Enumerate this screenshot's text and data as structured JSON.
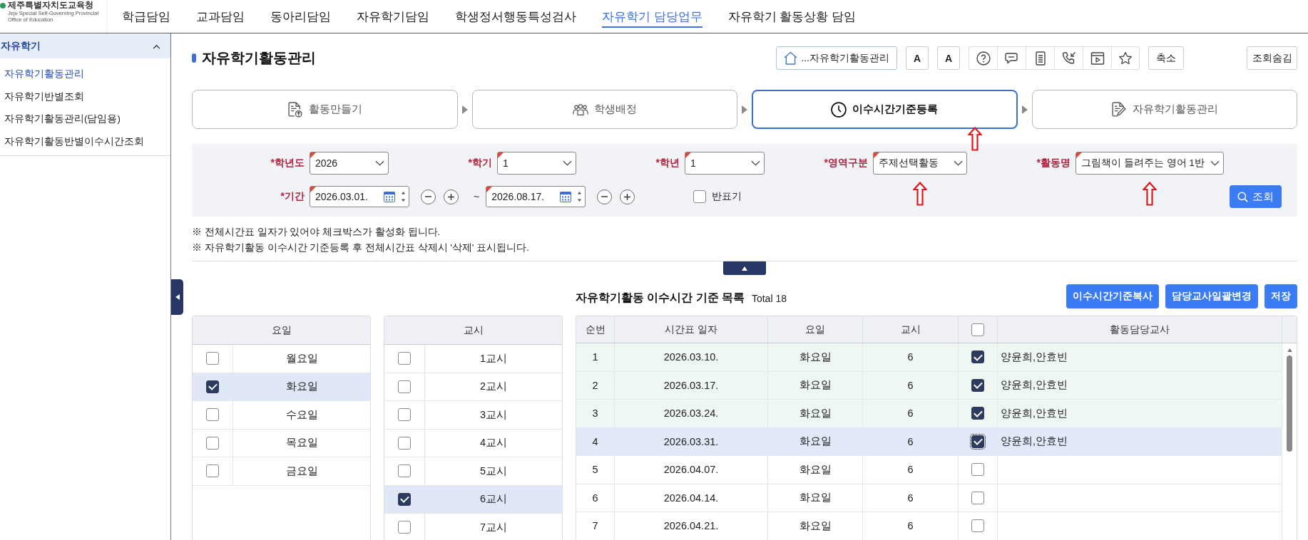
{
  "header": {
    "logo": {
      "title": "제주특별자치도교육청",
      "subtitle": "Jeju Special Self-Governing Provincial Office of Education"
    },
    "nav": [
      {
        "label": "학급담임",
        "selected": false
      },
      {
        "label": "교과담임",
        "selected": false
      },
      {
        "label": "동아리담임",
        "selected": false
      },
      {
        "label": "자유학기담임",
        "selected": false
      },
      {
        "label": "학생정서행동특성검사",
        "selected": false
      },
      {
        "label": "자유학기 담당업무",
        "selected": true
      },
      {
        "label": "자유학기 활동상황 담임",
        "selected": false
      }
    ]
  },
  "sidebar": {
    "title": "자유학기",
    "expanded": true,
    "items": [
      {
        "label": "자유학기활동관리",
        "selected": true
      },
      {
        "label": "자유학기반별조회",
        "selected": false
      },
      {
        "label": "자유학기활동관리(담임용)",
        "selected": false
      },
      {
        "label": "자유학기활동반별이수시간조회",
        "selected": false
      }
    ]
  },
  "page": {
    "title": "자유학기활동관리"
  },
  "toolbar": {
    "breadcrumb": "...자유학기활동관리",
    "font_buttons": [
      "A",
      "A"
    ],
    "collapse_button": "축소",
    "hide_search_button": "조회숨김"
  },
  "steps": [
    {
      "label": "활동만들기",
      "selected": false,
      "marked": false
    },
    {
      "label": "학생배정",
      "selected": false,
      "marked": false
    },
    {
      "label": "이수시간기준등록",
      "selected": true,
      "marked": true
    },
    {
      "label": "자유학기활동관리",
      "selected": false,
      "marked": false
    }
  ],
  "filters": {
    "selects": [
      {
        "label": "*학년도",
        "value": "2026",
        "marked": false
      },
      {
        "label": "*학기",
        "value": "1",
        "marked": false
      },
      {
        "label": "*학년",
        "value": "1",
        "marked": false
      },
      {
        "label": "*영역구분",
        "value": "주제선택활동",
        "marked": true
      },
      {
        "label": "*활동명",
        "value": "그림책이 들려주는 영어 1반",
        "marked": true
      }
    ],
    "period": {
      "label": "*기간",
      "start": "2026.03.01.",
      "separator": "~",
      "end": "2026.08.17."
    },
    "class_display": {
      "label": "반표기",
      "checked": false
    },
    "search_button": "조회"
  },
  "notes": [
    "※ 전체시간표 일자가 있어야 체크박스가 활성화 됩니다.",
    "※ 자유학기활동 이수시간 기준등록 후 전체시간표 삭제시 '삭제' 표시됩니다."
  ],
  "day_table": {
    "header": "요일",
    "rows": [
      {
        "label": "월요일",
        "checked": false
      },
      {
        "label": "화요일",
        "checked": true
      },
      {
        "label": "수요일",
        "checked": false
      },
      {
        "label": "목요일",
        "checked": false
      },
      {
        "label": "금요일",
        "checked": false
      }
    ]
  },
  "period_table": {
    "header": "교시",
    "rows": [
      {
        "label": "1교시",
        "checked": false
      },
      {
        "label": "2교시",
        "checked": false
      },
      {
        "label": "3교시",
        "checked": false
      },
      {
        "label": "4교시",
        "checked": false
      },
      {
        "label": "5교시",
        "checked": false
      },
      {
        "label": "6교시",
        "checked": true
      },
      {
        "label": "7교시",
        "checked": false
      }
    ]
  },
  "schedule": {
    "title": "자유학기활동 이수시간 기준 목록",
    "total": "Total 18",
    "buttons": [
      "이수시간기준복사",
      "담당교사일괄변경",
      "저장"
    ],
    "columns": [
      {
        "kind": "text",
        "label": "순번"
      },
      {
        "kind": "text",
        "label": "시간표 일자"
      },
      {
        "kind": "text",
        "label": "요일"
      },
      {
        "kind": "text",
        "label": "교시"
      },
      {
        "kind": "checkbox",
        "checked": false
      },
      {
        "kind": "text",
        "label": "활동담당교사"
      }
    ],
    "rows": [
      {
        "no": "1",
        "date": "2026.03.10.",
        "day": "화요일",
        "period": "6",
        "checked": true,
        "selected": false,
        "teachers": "양윤희,안효빈"
      },
      {
        "no": "2",
        "date": "2026.03.17.",
        "day": "화요일",
        "period": "6",
        "checked": true,
        "selected": false,
        "teachers": "양윤희,안효빈"
      },
      {
        "no": "3",
        "date": "2026.03.24.",
        "day": "화요일",
        "period": "6",
        "checked": true,
        "selected": false,
        "teachers": "양윤희,안효빈"
      },
      {
        "no": "4",
        "date": "2026.03.31.",
        "day": "화요일",
        "period": "6",
        "checked": true,
        "selected": true,
        "teachers": "양윤희,안효빈"
      },
      {
        "no": "5",
        "date": "2026.04.07.",
        "day": "화요일",
        "period": "6",
        "checked": false,
        "selected": false
      },
      {
        "no": "6",
        "date": "2026.04.14.",
        "day": "화요일",
        "period": "6",
        "checked": false,
        "selected": false
      },
      {
        "no": "7",
        "date": "2026.04.21.",
        "day": "화요일",
        "period": "6",
        "checked": false,
        "selected": false
      }
    ]
  }
}
